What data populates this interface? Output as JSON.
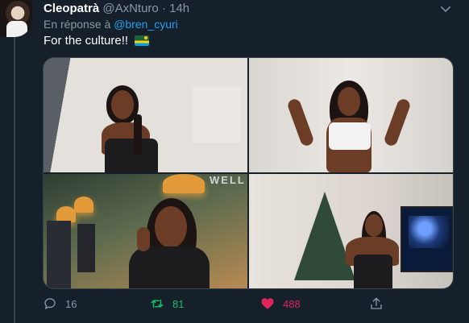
{
  "author": {
    "display_name": "Cleopatrà",
    "handle": "@AxNturo",
    "separator": "·",
    "time": "14h"
  },
  "reply": {
    "prefix": "En réponse à",
    "mention": "@bren_cyuri"
  },
  "tweet": {
    "text": "For the culture!!",
    "emoji": "rwanda-flag"
  },
  "media": {
    "photos": 4,
    "sign_text": "WELL"
  },
  "actions": {
    "reply_count": "16",
    "retweet_count": "81",
    "like_count": "488"
  },
  "colors": {
    "background": "#15202b",
    "text": "#ffffff",
    "muted": "#8899a6",
    "link": "#1da1f2",
    "retweet": "#17bf63",
    "like": "#e0245e",
    "border": "#38444d"
  },
  "icons": [
    "chevron-down-icon",
    "reply-icon",
    "retweet-icon",
    "heart-icon",
    "share-icon"
  ]
}
